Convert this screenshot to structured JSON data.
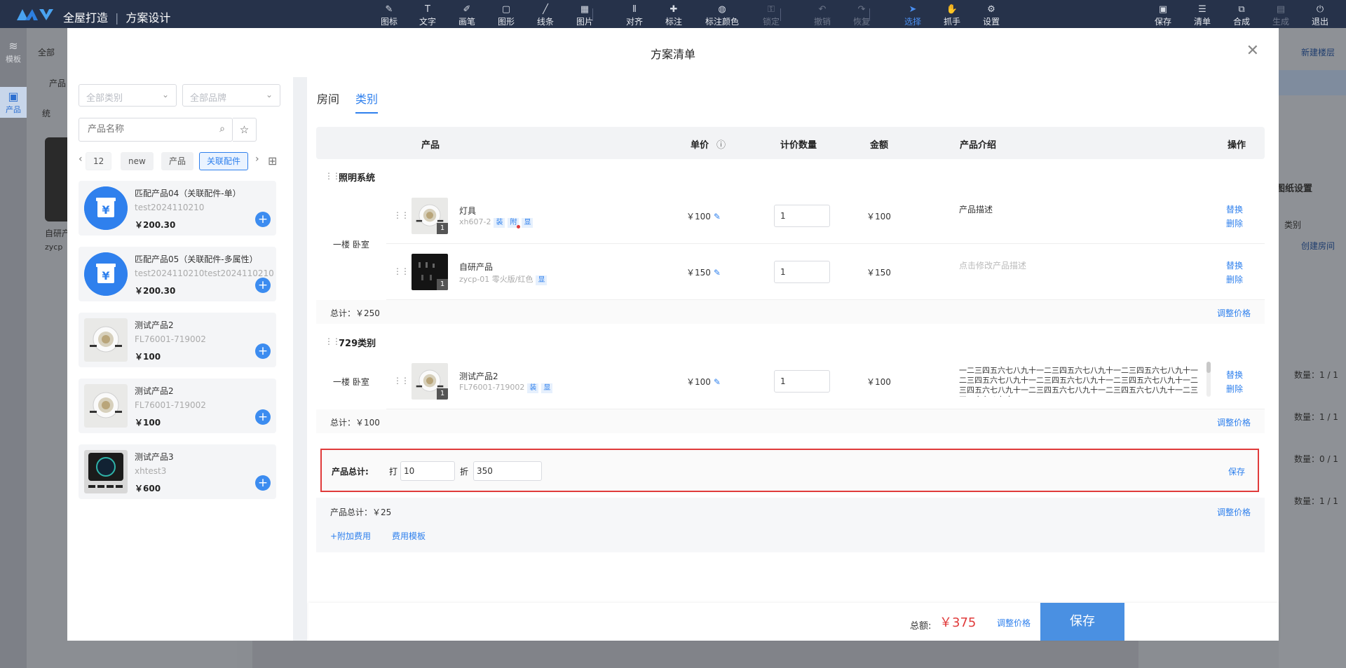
{
  "app": {
    "brand": "全屋打造",
    "project": "方案设计"
  },
  "toolbar": {
    "tools": [
      {
        "label": "图标",
        "icon": "icon-tool-icon"
      },
      {
        "label": "文字",
        "icon": "text-icon"
      },
      {
        "label": "画笔",
        "icon": "brush-icon"
      },
      {
        "label": "图形",
        "icon": "shape-icon"
      },
      {
        "label": "线条",
        "icon": "line-icon"
      },
      {
        "label": "图片",
        "icon": "image-icon"
      },
      {
        "label": "对齐",
        "icon": "align-icon"
      },
      {
        "label": "标注",
        "icon": "pin-icon"
      },
      {
        "label": "标注颜色",
        "icon": "palette-icon"
      },
      {
        "label": "锁定",
        "icon": "lock-icon"
      },
      {
        "label": "撤销",
        "icon": "undo-icon"
      },
      {
        "label": "恢复",
        "icon": "redo-icon"
      },
      {
        "label": "选择",
        "icon": "cursor-icon"
      },
      {
        "label": "抓手",
        "icon": "hand-icon"
      },
      {
        "label": "设置",
        "icon": "gear-icon"
      }
    ],
    "right": [
      {
        "label": "保存",
        "icon": "save-icon"
      },
      {
        "label": "清单",
        "icon": "list-icon"
      },
      {
        "label": "合成",
        "icon": "merge-icon"
      },
      {
        "label": "生成",
        "icon": "generate-icon"
      },
      {
        "label": "退出",
        "icon": "exit-icon"
      }
    ]
  },
  "leftrail": {
    "items": [
      {
        "label": "模板",
        "icon": "layers-icon"
      },
      {
        "label": "产品",
        "icon": "cube-icon"
      }
    ]
  },
  "background": {
    "left_select": "全部",
    "left_input": "产品",
    "left_crumb": "统",
    "left_card_name": "自研产",
    "left_card_code": "zycp",
    "right_new_floor": "新建楼层",
    "right_settings": "图纸设置",
    "right_input": "类别",
    "right_create_room": "创建房间",
    "counts": [
      "数量：1 / 1",
      "数量：1 / 1",
      "数量：0 / 1",
      "数量：1 / 1"
    ]
  },
  "modal": {
    "title": "方案清单"
  },
  "filters": {
    "category": "全部类别",
    "brand": "全部品牌",
    "search_placeholder": "产品名称"
  },
  "chips": [
    {
      "label": "12"
    },
    {
      "label": "new"
    },
    {
      "label": "产品"
    },
    {
      "label": "关联配件",
      "active": true
    }
  ],
  "products": [
    {
      "name": "匹配产品04（关联配件-单）",
      "code": "test2024110210",
      "price": "￥200.30",
      "thumb": "yen"
    },
    {
      "name": "匹配产品05（关联配件-多属性）",
      "code": "test2024110210test2024110210",
      "price": "￥200.30",
      "thumb": "yen"
    },
    {
      "name": "测试产品2",
      "code": "FL76001-719002",
      "price": "￥100",
      "thumb": "light"
    },
    {
      "name": "测试产品2",
      "code": "FL76001-719002",
      "price": "￥100",
      "thumb": "light"
    },
    {
      "name": "测试产品3",
      "code": "xhtest3",
      "price": "￥600",
      "thumb": "panel"
    }
  ],
  "tabs": [
    {
      "label": "房间"
    },
    {
      "label": "类别",
      "active": true
    }
  ],
  "table": {
    "headers": {
      "product": "产品",
      "unit_price": "单价",
      "qty": "计价数量",
      "amount": "金额",
      "intro": "产品介绍",
      "ops": "操作"
    }
  },
  "groups": [
    {
      "title": "照明系统",
      "room": "一楼 卧室",
      "subtotal": "总计：￥250",
      "adjust": "调整价格",
      "rows": [
        {
          "name": "灯具",
          "code": "xh607-2",
          "tags": [
            "装",
            "附",
            "显"
          ],
          "unit_price": "￥100",
          "qty": "1",
          "amount": "￥100",
          "desc": "产品描述",
          "desc_placeholder": false,
          "img_qty": "1",
          "thumb": "light"
        },
        {
          "name": "自研产品",
          "code": "zycp-01 零火版/红色",
          "tags": [
            "显"
          ],
          "unit_price": "￥150",
          "qty": "1",
          "amount": "￥150",
          "desc": "点击修改产品描述",
          "desc_placeholder": true,
          "img_qty": "1",
          "thumb": "socket"
        }
      ]
    },
    {
      "title": "729类别",
      "room": "一楼 卧室",
      "subtotal": "总计：￥100",
      "adjust": "调整价格",
      "rows": [
        {
          "name": "测试产品2",
          "code": "FL76001-719002",
          "tags": [
            "装",
            "显"
          ],
          "unit_price": "￥100",
          "qty": "1",
          "amount": "￥100",
          "desc": "一二三四五六七八九十一二三四五六七八九十一二三四五六七八九十一二三四五六七八九十一二三四五六七八九十一二三四五六七八九十一二三四五六七八九十一二三四五六七八九十一二三四五六七八九十一二三四五六七八九十",
          "desc_placeholder": false,
          "img_qty": "1",
          "thumb": "light"
        }
      ]
    }
  ],
  "op_labels": {
    "replace": "替换",
    "delete": "删除"
  },
  "discount": {
    "label": "产品总计:",
    "da": "打",
    "zhe": "折",
    "rate": "10",
    "value": "350",
    "save": "保存"
  },
  "summary": {
    "label": "产品总计：￥25",
    "adjust": "调整价格",
    "add_fee": "+附加费用",
    "fee_template": "费用模板"
  },
  "footer": {
    "total_label": "总额:",
    "total_value": "￥375",
    "adjust": "调整价格",
    "save": "保存"
  },
  "colors": {
    "accent": "#2f80ed",
    "danger": "#e03b3b",
    "topbar": "#26324a"
  }
}
